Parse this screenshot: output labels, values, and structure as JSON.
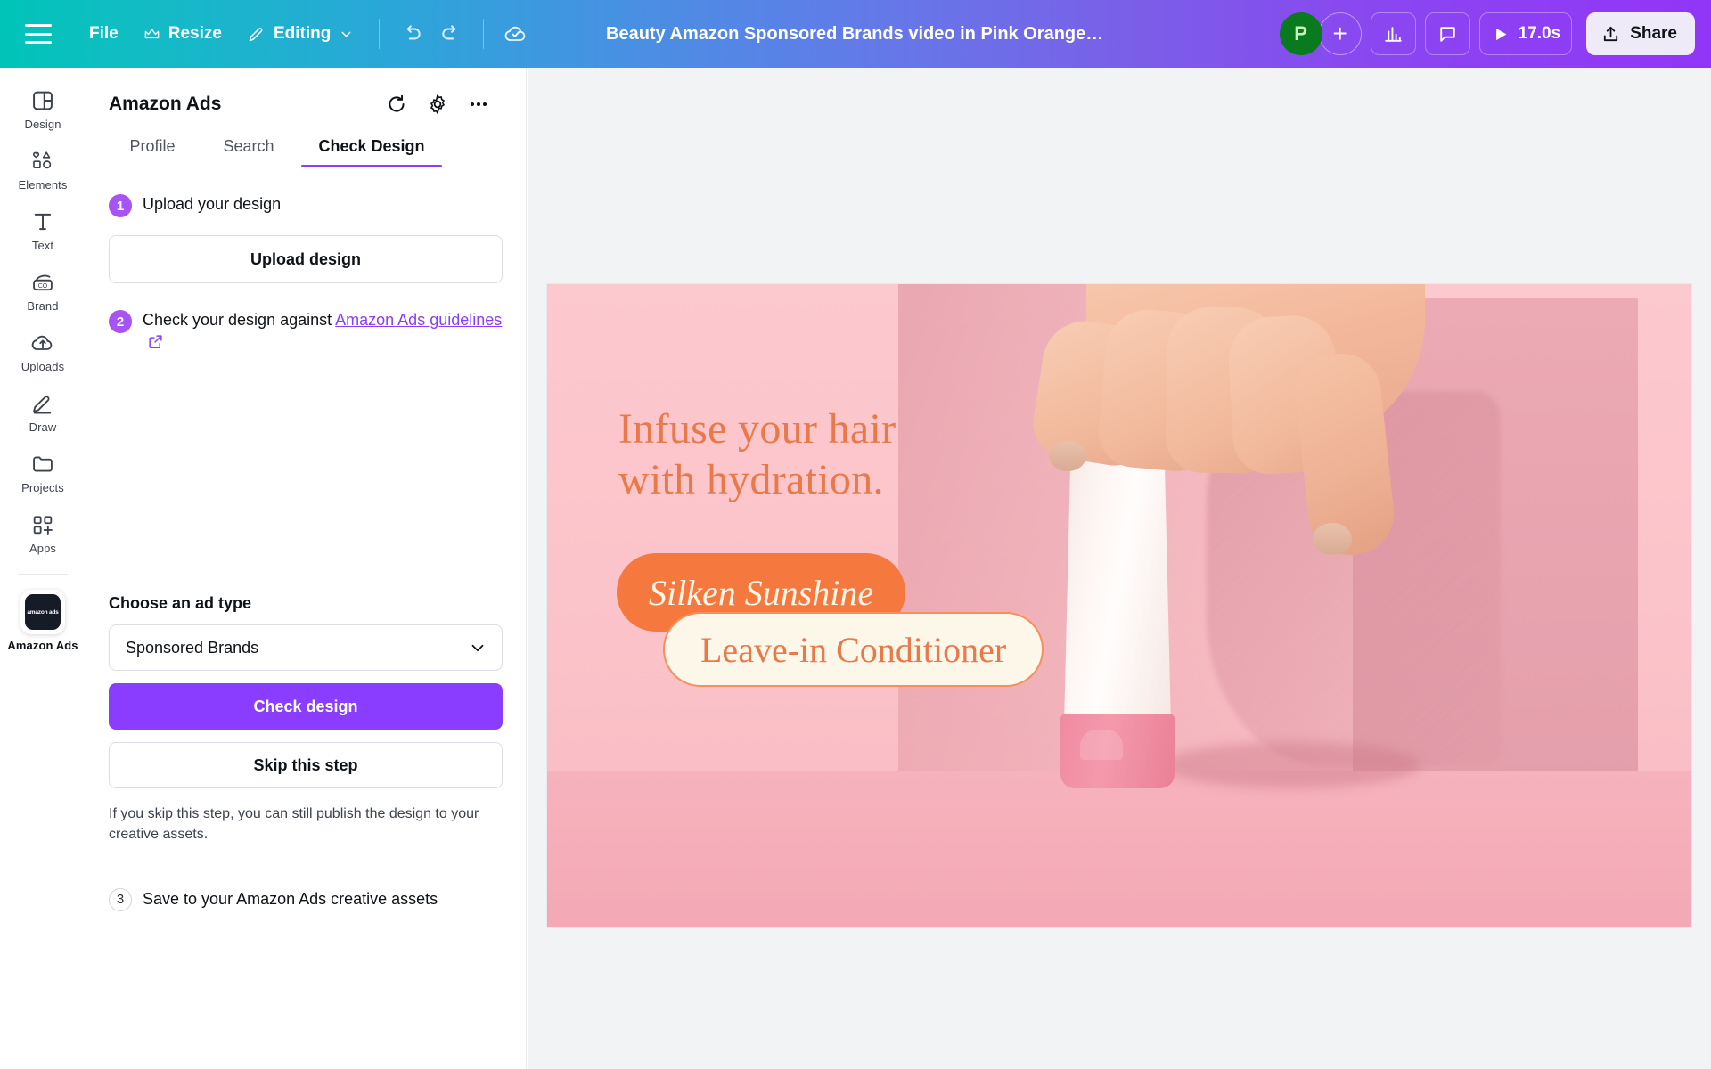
{
  "topbar": {
    "menu_icon": "hamburger-icon",
    "file_label": "File",
    "resize_label": "Resize",
    "resize_icon": "crown-icon",
    "editing_label": "Editing",
    "editing_icon": "pencil-icon",
    "chevron_icon": "chevron-down-icon",
    "undo_icon": "undo-icon",
    "redo_icon": "redo-icon",
    "saved_icon": "cloud-check-icon",
    "doc_title": "Beauty Amazon Sponsored Brands video in Pink Orange Wh...",
    "avatar_initial": "P",
    "add_person_icon": "plus-icon",
    "insights_icon": "bar-chart-icon",
    "comment_icon": "comment-icon",
    "play_icon": "play-icon",
    "duration": "17.0s",
    "share_label": "Share",
    "share_icon": "upload-icon"
  },
  "rail": {
    "items": [
      {
        "label": "Design",
        "icon": "layout-icon",
        "active": false
      },
      {
        "label": "Elements",
        "icon": "shapes-icon",
        "active": false
      },
      {
        "label": "Text",
        "icon": "text-t-icon",
        "active": false
      },
      {
        "label": "Brand",
        "icon": "brand-icon",
        "active": false
      },
      {
        "label": "Uploads",
        "icon": "cloud-upload-icon",
        "active": false
      },
      {
        "label": "Draw",
        "icon": "pen-icon",
        "active": false
      },
      {
        "label": "Projects",
        "icon": "folder-icon",
        "active": false
      },
      {
        "label": "Apps",
        "icon": "apps-grid-plus-icon",
        "active": false
      }
    ],
    "app": {
      "label": "Amazon Ads",
      "logo_text": "amazon ads",
      "active": true
    }
  },
  "panel": {
    "title": "Amazon Ads",
    "refresh_icon": "refresh-icon",
    "settings_icon": "gear-icon",
    "more_icon": "ellipsis-icon",
    "tabs": [
      {
        "label": "Profile",
        "active": false
      },
      {
        "label": "Search",
        "active": false
      },
      {
        "label": "Check Design",
        "active": true
      }
    ],
    "step1": {
      "number": "1",
      "text": "Upload your design",
      "button": "Upload design"
    },
    "step2": {
      "number": "2",
      "text_before": "Check your design against ",
      "link_text": "Amazon Ads guidelines",
      "external_icon": "external-link-icon"
    },
    "ad_type": {
      "label": "Choose an ad type",
      "selected": "Sponsored Brands",
      "chevron_icon": "chevron-down-icon"
    },
    "check_button": "Check design",
    "skip_button": "Skip this step",
    "note": "If you skip this step, you can still publish the design to your creative assets.",
    "step3": {
      "number": "3",
      "text": "Save to your Amazon Ads creative assets"
    }
  },
  "design": {
    "headline_line1": "Infuse your hair",
    "headline_line2": "with hydration.",
    "pill_brand": "Silken Sunshine",
    "pill_product": "Leave-in Conditioner",
    "colors": {
      "background_pink": "#FBC9CE",
      "floor_pink": "#F5B0BB",
      "orange": "#F5793F",
      "headline_orange": "#E87A4A",
      "cream": "#FDF7E9",
      "cap_pink": "#F08BA1"
    }
  },
  "theme": {
    "brand_purple": "#8B3DFF",
    "badge_purple": "#A854F5",
    "avatar_green": "#0A7A1E"
  }
}
